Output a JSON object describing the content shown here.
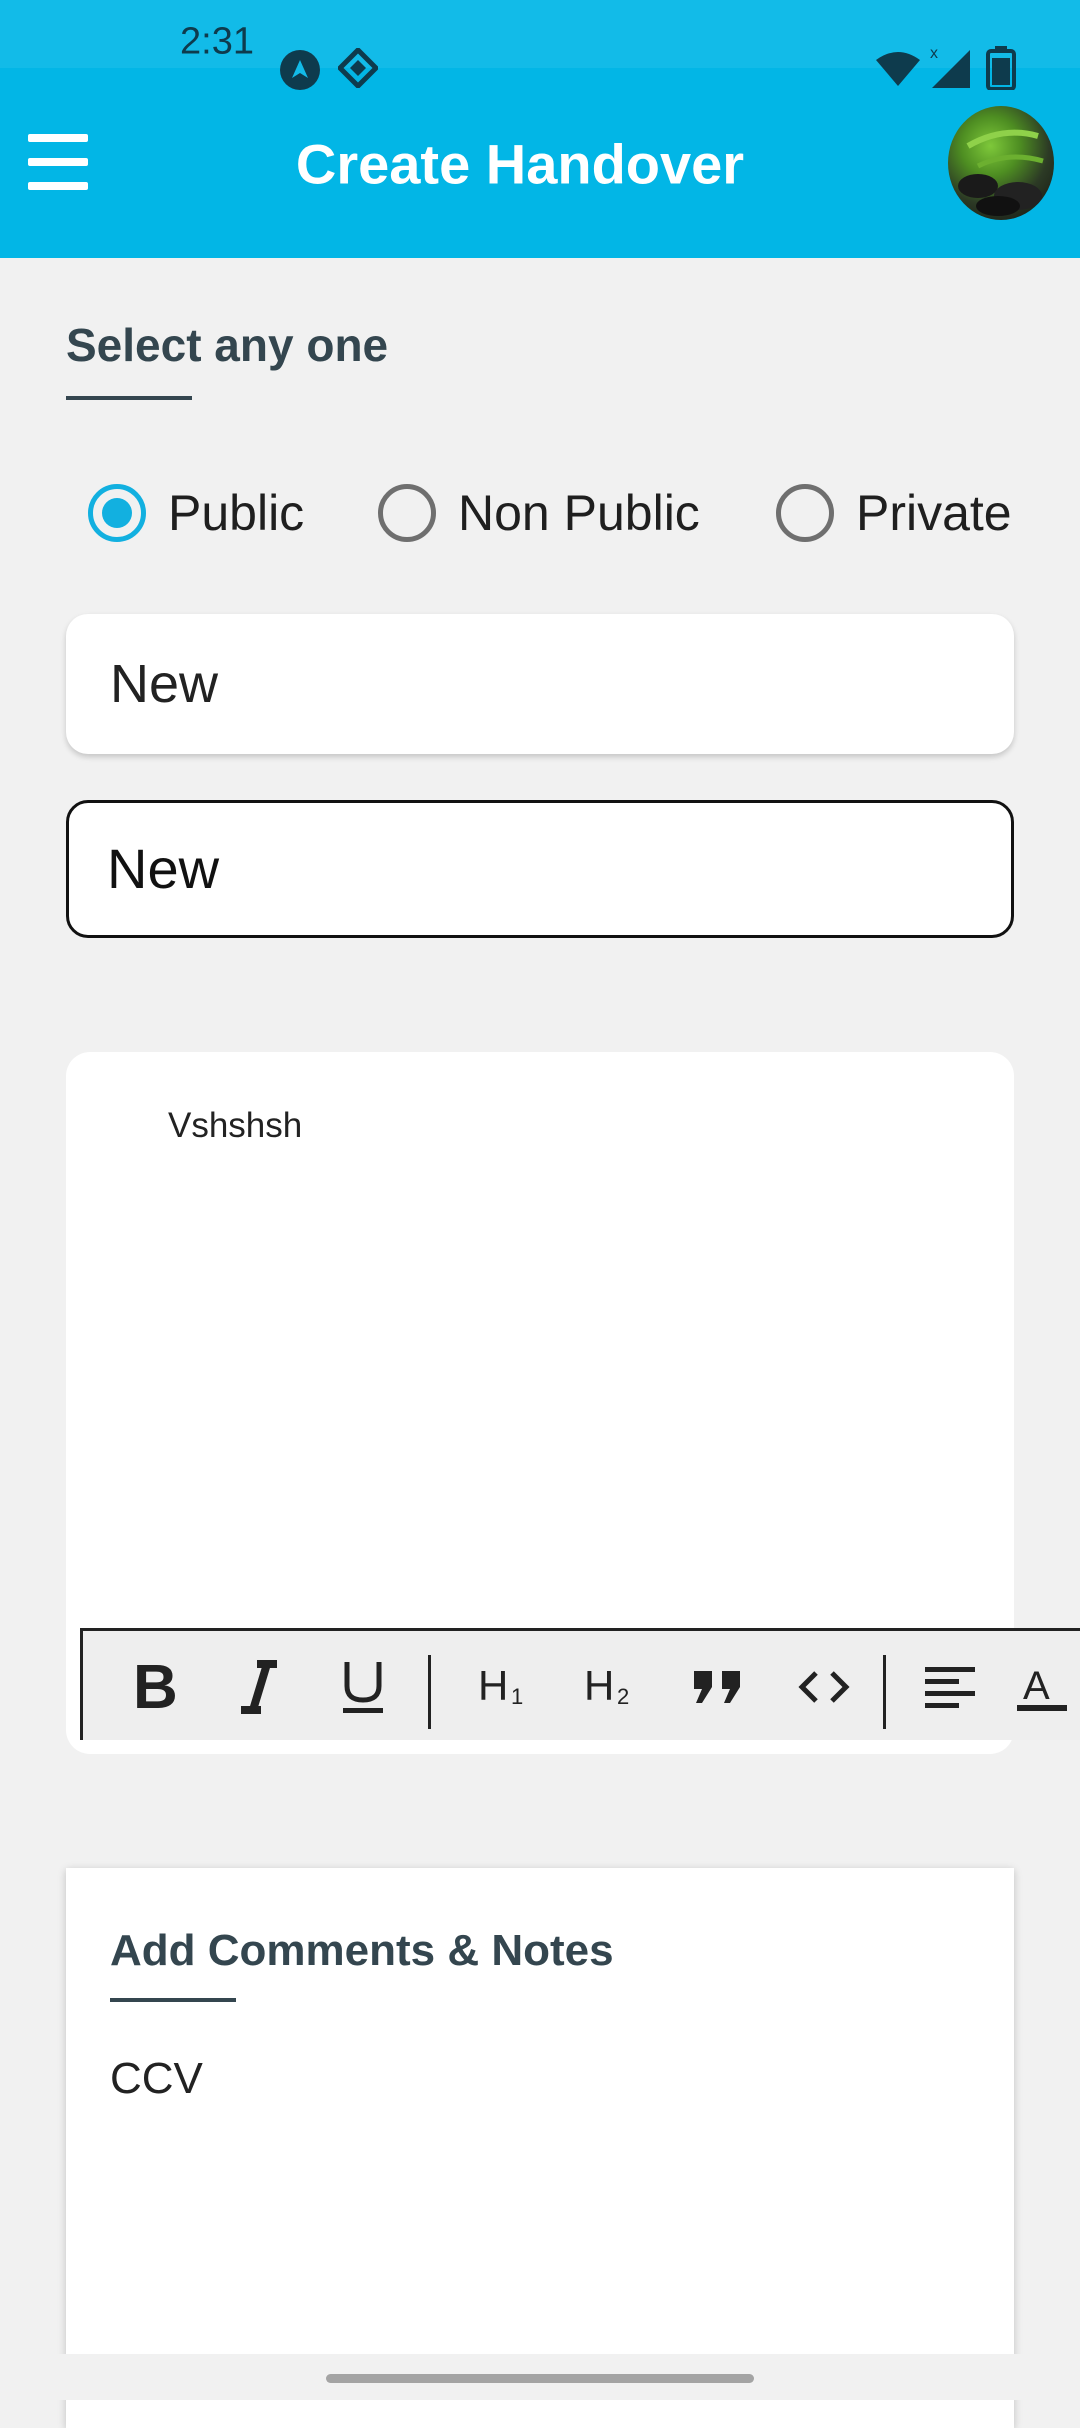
{
  "status_bar": {
    "time": "2:31",
    "icons": [
      "nav-arrow-icon",
      "diamond-icon",
      "wifi-icon",
      "signal-icon",
      "battery-icon"
    ]
  },
  "toolbar": {
    "title": "Create Handover",
    "menu_icon": "hamburger-menu-icon",
    "avatar": "profile-avatar"
  },
  "colors": {
    "primary": "#02b6e6",
    "radio_selected": "#12b0e0",
    "heading": "#34464f"
  },
  "form": {
    "select_title": "Select any one",
    "options": [
      {
        "label": "Public",
        "selected": true
      },
      {
        "label": "Non Public",
        "selected": false
      },
      {
        "label": "Private",
        "selected": false
      }
    ],
    "field1_value": "New",
    "field2_value": "New"
  },
  "editor": {
    "content": "Vshshsh",
    "toolbar": [
      "bold-icon",
      "italic-icon",
      "underline-icon",
      "heading1-icon",
      "heading2-icon",
      "quote-icon",
      "code-icon",
      "align-left-icon",
      "text-color-icon"
    ]
  },
  "comments": {
    "title": "Add Comments & Notes",
    "text": "CCV"
  }
}
